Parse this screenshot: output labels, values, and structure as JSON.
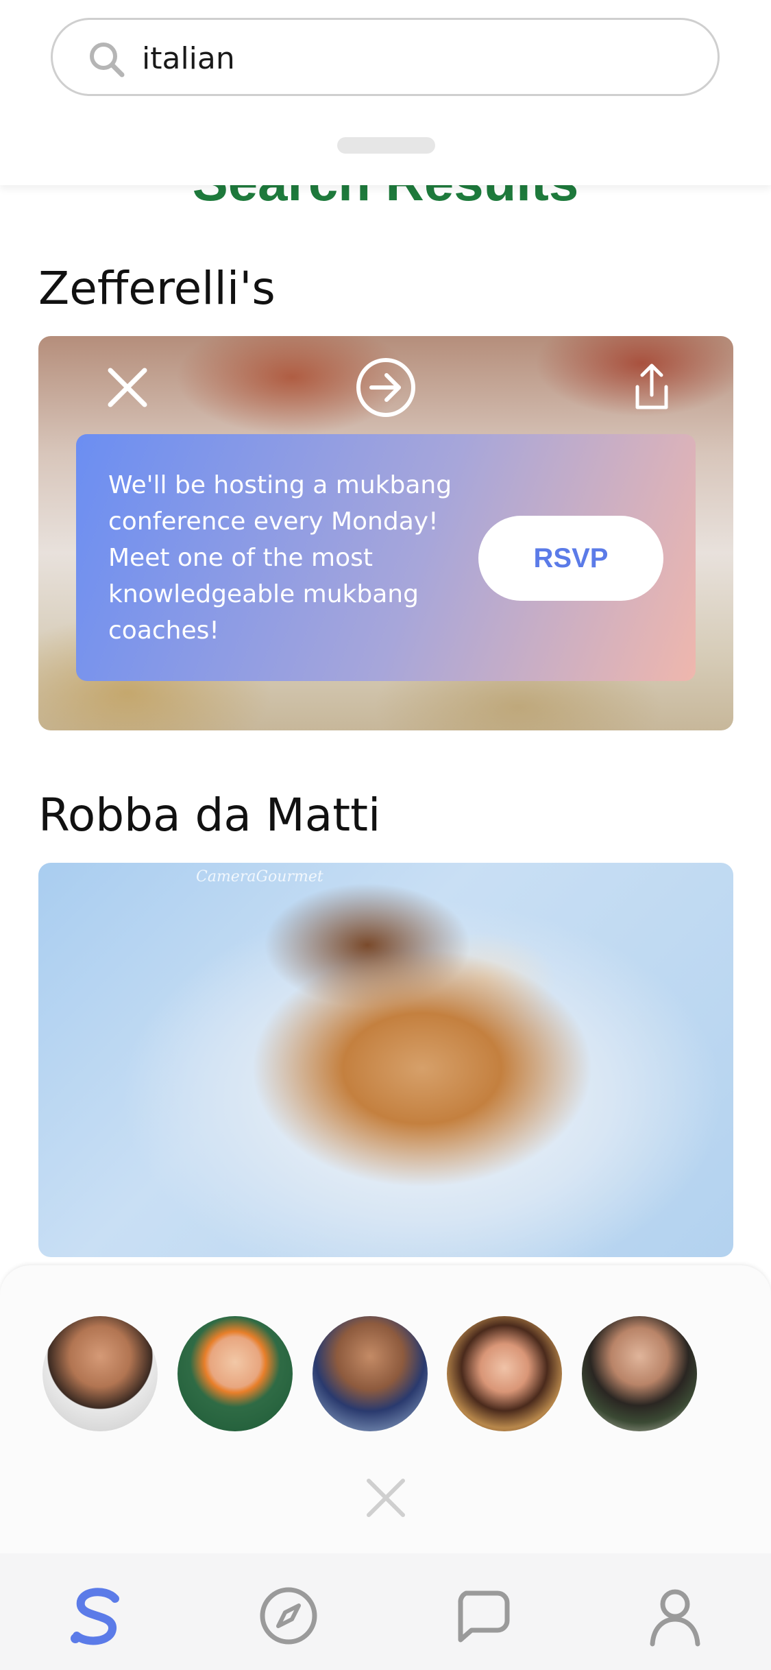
{
  "search": {
    "query": "italian"
  },
  "results": {
    "title": "Search Results",
    "restaurants": [
      {
        "name": "Zefferelli's",
        "promo_text": "We'll be hosting a mukbang conference every Monday! Meet one of the most knowledgeable mukbang coaches!",
        "rsvp_label": "RSVP"
      },
      {
        "name": "Robba da Matti",
        "watermark": "CameraGourmet"
      }
    ]
  },
  "friends": {
    "avatars": [
      "avatar-1",
      "avatar-2",
      "avatar-3",
      "avatar-4",
      "avatar-5"
    ]
  },
  "nav": {
    "items": [
      "home-logo-icon",
      "compass-icon",
      "chat-bubble-icon",
      "profile-icon"
    ],
    "active_color": "#5b7be8"
  },
  "colors": {
    "accent": "#5b7be8",
    "title_green": "#1e7a3c"
  }
}
